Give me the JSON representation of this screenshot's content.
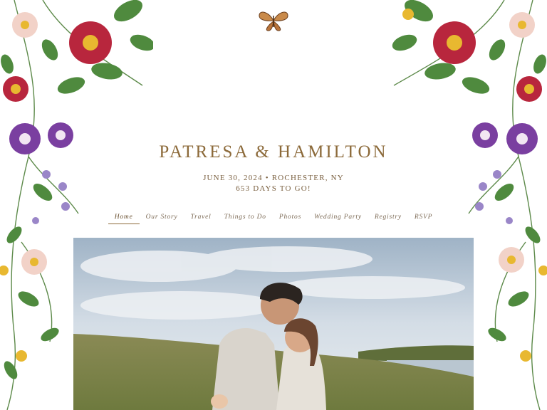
{
  "header": {
    "couple_names": "PATRESA & HAMILTON",
    "date_location": "JUNE 30, 2024 • ROCHESTER, NY",
    "countdown": "653 DAYS TO GO!"
  },
  "nav": {
    "items": [
      {
        "label": "Home",
        "active": true
      },
      {
        "label": "Our Story"
      },
      {
        "label": "Travel"
      },
      {
        "label": "Things to Do"
      },
      {
        "label": "Photos"
      },
      {
        "label": "Wedding Party"
      },
      {
        "label": "Registry"
      },
      {
        "label": "RSVP"
      }
    ]
  },
  "decor": {
    "butterfly_icon": "butterfly-icon",
    "accent_color": "#8c6a3a",
    "flower_colors": [
      "#b8263d",
      "#7a3fa0",
      "#f2d2c8",
      "#e8b830"
    ]
  },
  "hero_photo": {
    "subject": "couple-photo"
  }
}
